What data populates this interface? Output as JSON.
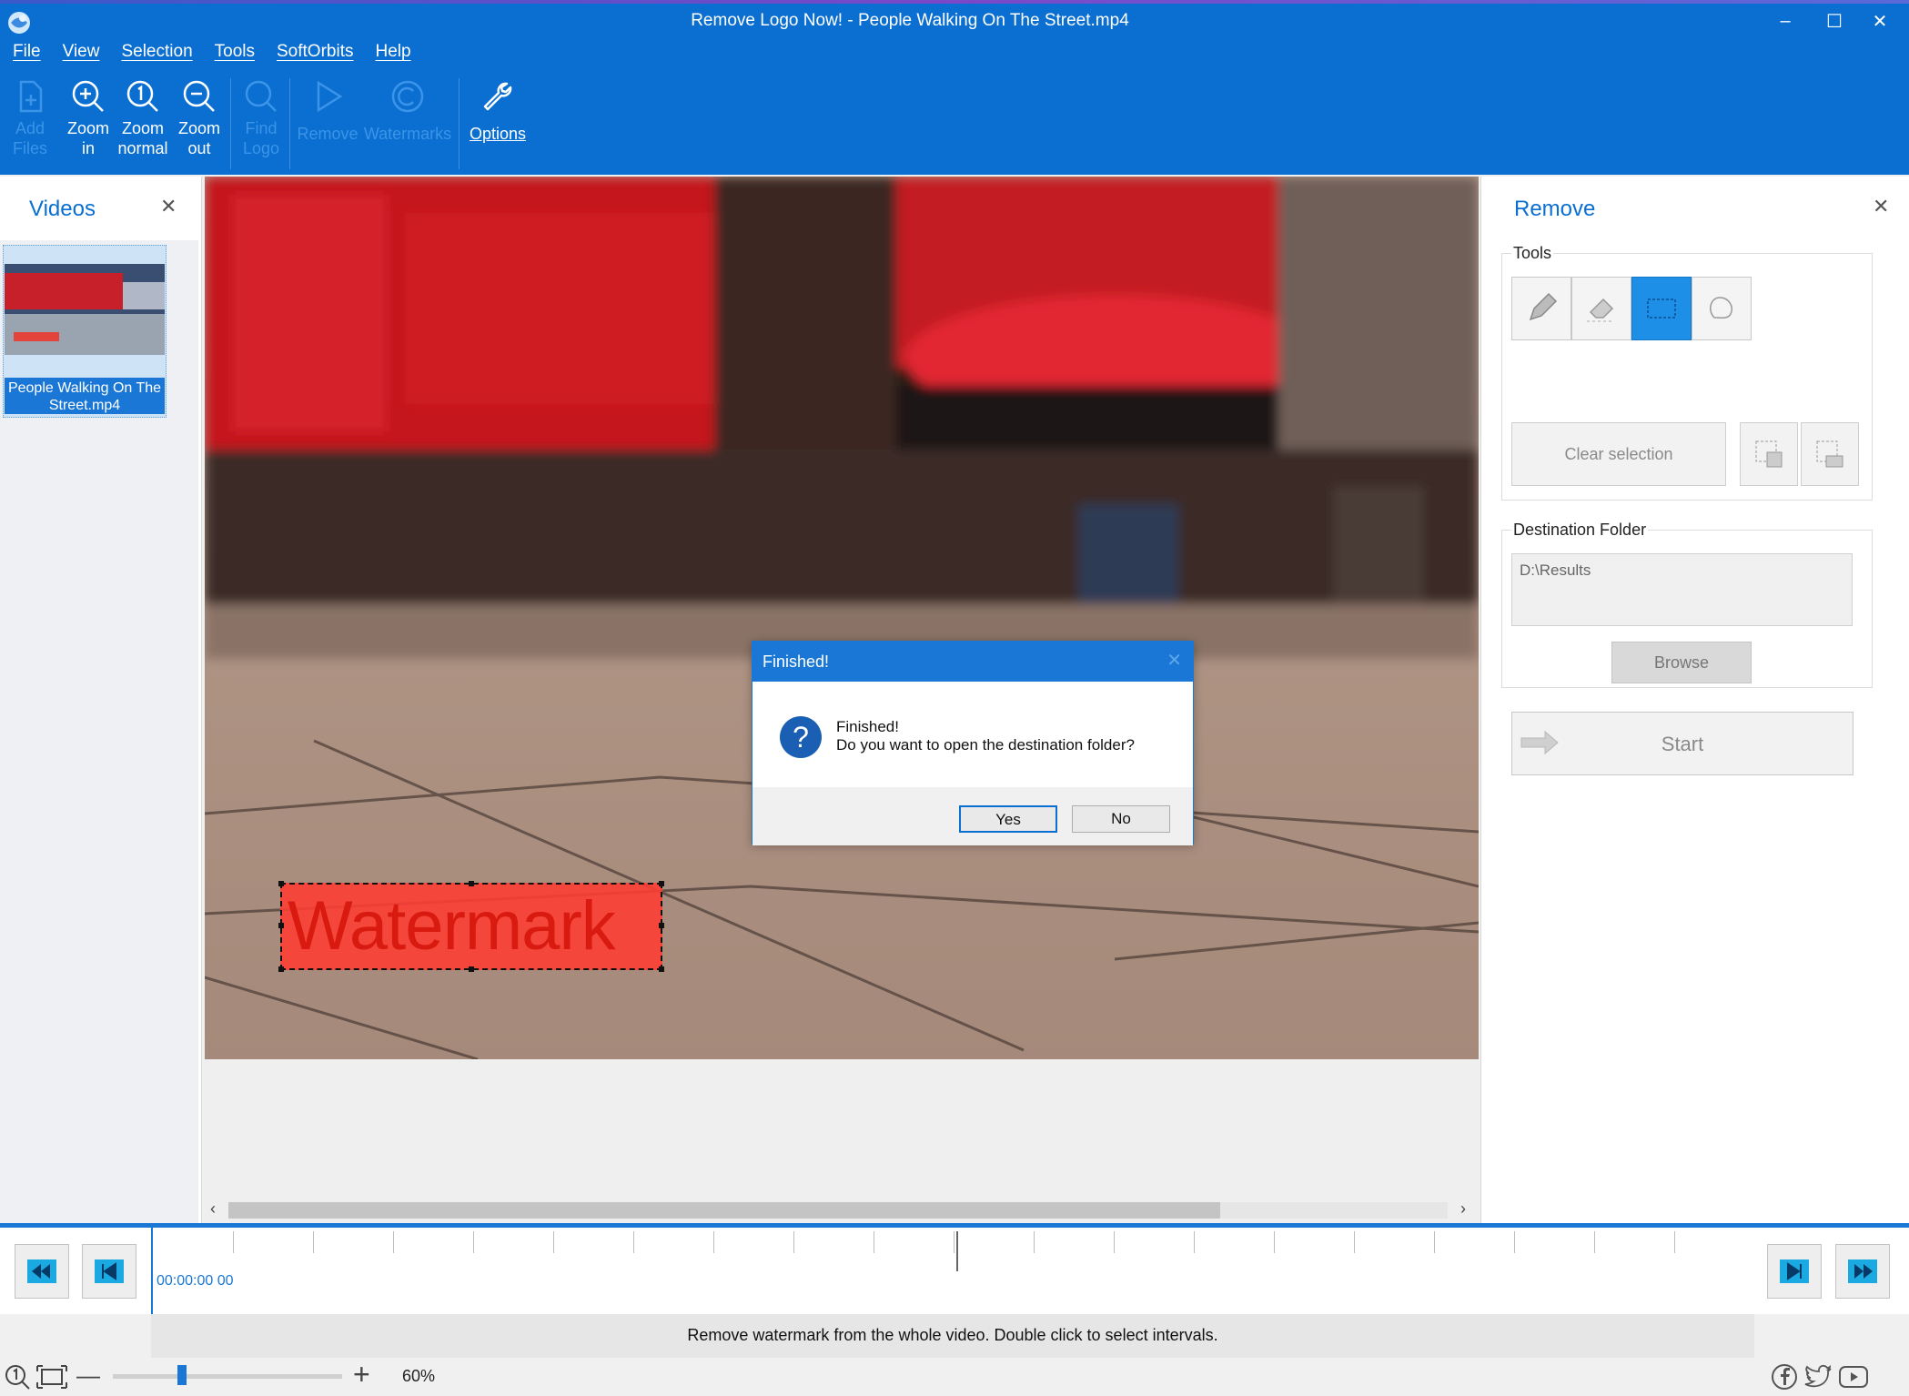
{
  "window": {
    "title": "Remove Logo Now! - People Walking On The Street.mp4"
  },
  "menu": [
    "File",
    "View",
    "Selection",
    "Tools",
    "SoftOrbits",
    "Help"
  ],
  "toolbar": {
    "add_files": "Add Files",
    "zoom_in": "Zoom in",
    "zoom_normal": "Zoom normal",
    "zoom_out": "Zoom out",
    "find_logo": "Find Logo",
    "remove": "Remove",
    "watermarks": "Watermarks",
    "options": "Options"
  },
  "videos_panel": {
    "title": "Videos",
    "items": [
      {
        "label": "People Walking On The Street.mp4"
      }
    ]
  },
  "preview": {
    "watermark_text": "Watermark"
  },
  "dialog": {
    "title": "Finished!",
    "line1": "Finished!",
    "line2": "Do you want to open the destination folder?",
    "yes": "Yes",
    "no": "No"
  },
  "remove_panel": {
    "title": "Remove",
    "tools_label": "Tools",
    "clear_selection": "Clear selection",
    "destination_label": "Destination Folder",
    "destination_value": "D:\\Results",
    "browse": "Browse",
    "start": "Start"
  },
  "timeline": {
    "timecode": "00:00:00 00"
  },
  "status": {
    "message": "Remove watermark from the whole video. Double click to select intervals."
  },
  "zoom": {
    "value": "60%",
    "level": 0.3
  },
  "colors": {
    "accent": "#0a6fd1",
    "selection": "#ff3c32"
  }
}
